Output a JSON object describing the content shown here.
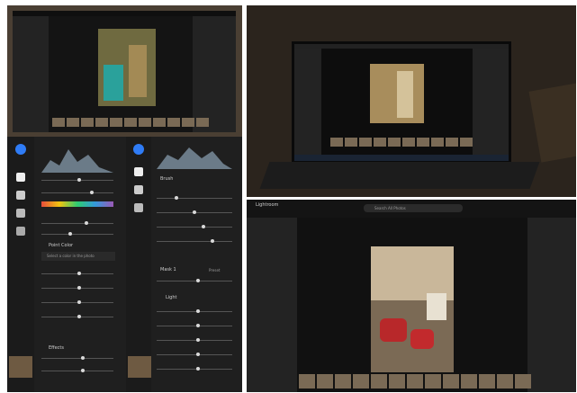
{
  "tiles": {
    "bottom_right": {
      "app_title": "Lightroom",
      "search_placeholder": "Search All Photos"
    },
    "left_panel": {
      "section_title": "Effects",
      "color_label": "Point Color",
      "picker_label": "Select a color in the photo"
    },
    "middle_panel": {
      "section_title": "Brush",
      "mask_title": "Mask 1",
      "mask_preset": "Preset",
      "light_title": "Light"
    }
  },
  "colors": {
    "lightroom_dark": "#1b1b1b",
    "accent_blue": "#2f7cf6"
  }
}
